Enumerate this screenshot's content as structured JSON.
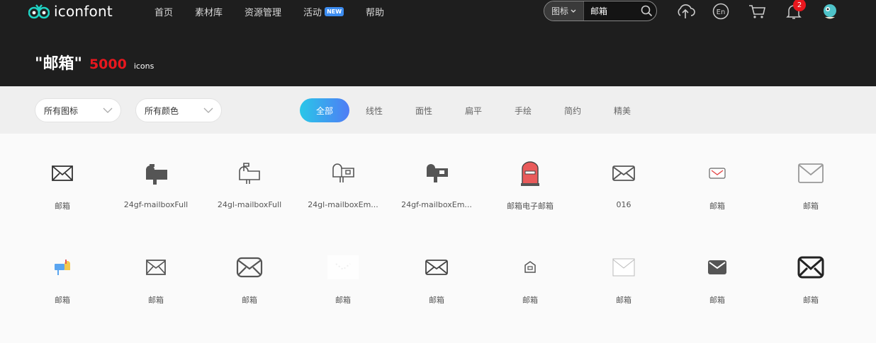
{
  "header": {
    "logo_text": "iconfont",
    "nav": [
      {
        "label": "首页"
      },
      {
        "label": "素材库"
      },
      {
        "label": "资源管理"
      },
      {
        "label": "活动",
        "badge": "NEW"
      },
      {
        "label": "帮助"
      }
    ],
    "search": {
      "type_label": "图标",
      "value": "邮箱"
    },
    "icons": [
      "upload-icon",
      "language-en-icon",
      "cart-icon",
      "bell-icon",
      "avatar"
    ],
    "notification_count": "2"
  },
  "hero": {
    "query": "\"邮箱\"",
    "count": "5000",
    "unit": "icons"
  },
  "filters": {
    "icon_type": "所有图标",
    "color_type": "所有颜色",
    "tabs": [
      "全部",
      "线性",
      "面性",
      "扁平",
      "手绘",
      "简约",
      "精美"
    ],
    "active_tab": "全部"
  },
  "icons_row1": [
    {
      "label": "邮箱",
      "icon": "envelope-outline"
    },
    {
      "label": "24gf-mailboxFull",
      "icon": "mailbox-filled"
    },
    {
      "label": "24gl-mailboxFull",
      "icon": "mailbox-outline"
    },
    {
      "label": "24gl-mailboxEm...",
      "icon": "mailbox-empty-outline"
    },
    {
      "label": "24gf-mailboxEm...",
      "icon": "mailbox-empty-filled"
    },
    {
      "label": "邮箱电子邮箱",
      "icon": "red-postbox"
    },
    {
      "label": "016",
      "icon": "envelope-outline"
    },
    {
      "label": "邮箱",
      "icon": "envelope-small-red"
    },
    {
      "label": "邮箱",
      "icon": "envelope-light"
    }
  ],
  "icons_row2": [
    {
      "label": "邮箱",
      "icon": "mailbox-color"
    },
    {
      "label": "邮箱",
      "icon": "envelope-outline"
    },
    {
      "label": "邮箱",
      "icon": "envelope-rounded"
    },
    {
      "label": "邮箱",
      "icon": "envelope-white"
    },
    {
      "label": "邮箱",
      "icon": "envelope-outline"
    },
    {
      "label": "邮箱",
      "icon": "mailbox-small"
    },
    {
      "label": "邮箱",
      "icon": "envelope-thin"
    },
    {
      "label": "邮箱",
      "icon": "envelope-filled"
    },
    {
      "label": "邮箱",
      "icon": "envelope-bold"
    }
  ],
  "colors": {
    "accent_red": "#e8171e",
    "tab_gradient_start": "#29c7e8",
    "tab_gradient_end": "#4f7cf5"
  }
}
